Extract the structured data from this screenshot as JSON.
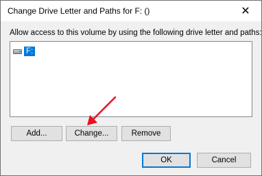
{
  "window": {
    "title": "Change Drive Letter and Paths for F: ()",
    "close_symbol": "✕"
  },
  "prompt": "Allow access to this volume by using the following drive letter and paths:",
  "paths_list": {
    "items": [
      {
        "label": "F:",
        "icon": "drive-icon",
        "selected": true
      }
    ]
  },
  "buttons": {
    "add": "Add...",
    "change": "Change...",
    "remove": "Remove",
    "ok": "OK",
    "cancel": "Cancel"
  },
  "annotation": {
    "color": "#e81123"
  },
  "colors": {
    "selection": "#0078d7",
    "default_button_border": "#0078d7"
  }
}
